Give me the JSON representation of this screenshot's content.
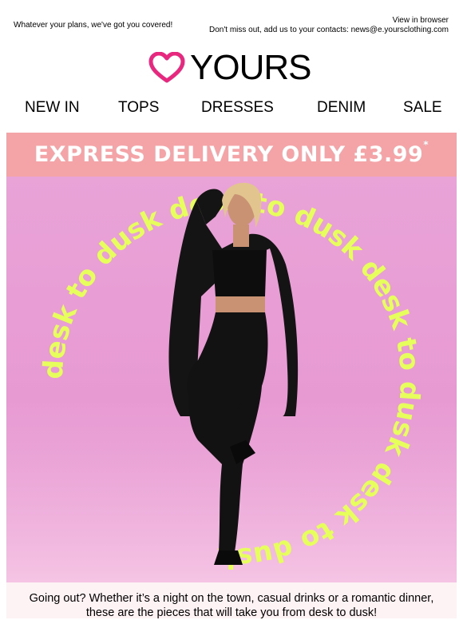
{
  "preheader": {
    "tagline": "Whatever your plans, we've got you covered!",
    "view_browser": "View in browser",
    "contacts_note": "Don't miss out, add us to your contacts: news@e.yoursclothing.com"
  },
  "logo": {
    "text": "YOURS",
    "icon": "heart-outline-icon",
    "color": "#e8287e"
  },
  "nav": {
    "items": [
      "NEW IN",
      "TOPS",
      "DRESSES",
      "DENIM",
      "SALE"
    ]
  },
  "banner": {
    "text": "EXPRESS DELIVERY ONLY £3.99",
    "asterisk": "*",
    "color": "#f4a3a6"
  },
  "hero": {
    "alt": "desk to dusk",
    "circle_text": "desk to dusk desk to dusk desk to dusk desk to dusk",
    "accent": "#e6ff5a"
  },
  "copy": {
    "line1": "Going out? Whether it’s a night on the town, casual drinks or a romantic dinner,",
    "line2": "these are the pieces that will take you from desk to dusk!"
  }
}
